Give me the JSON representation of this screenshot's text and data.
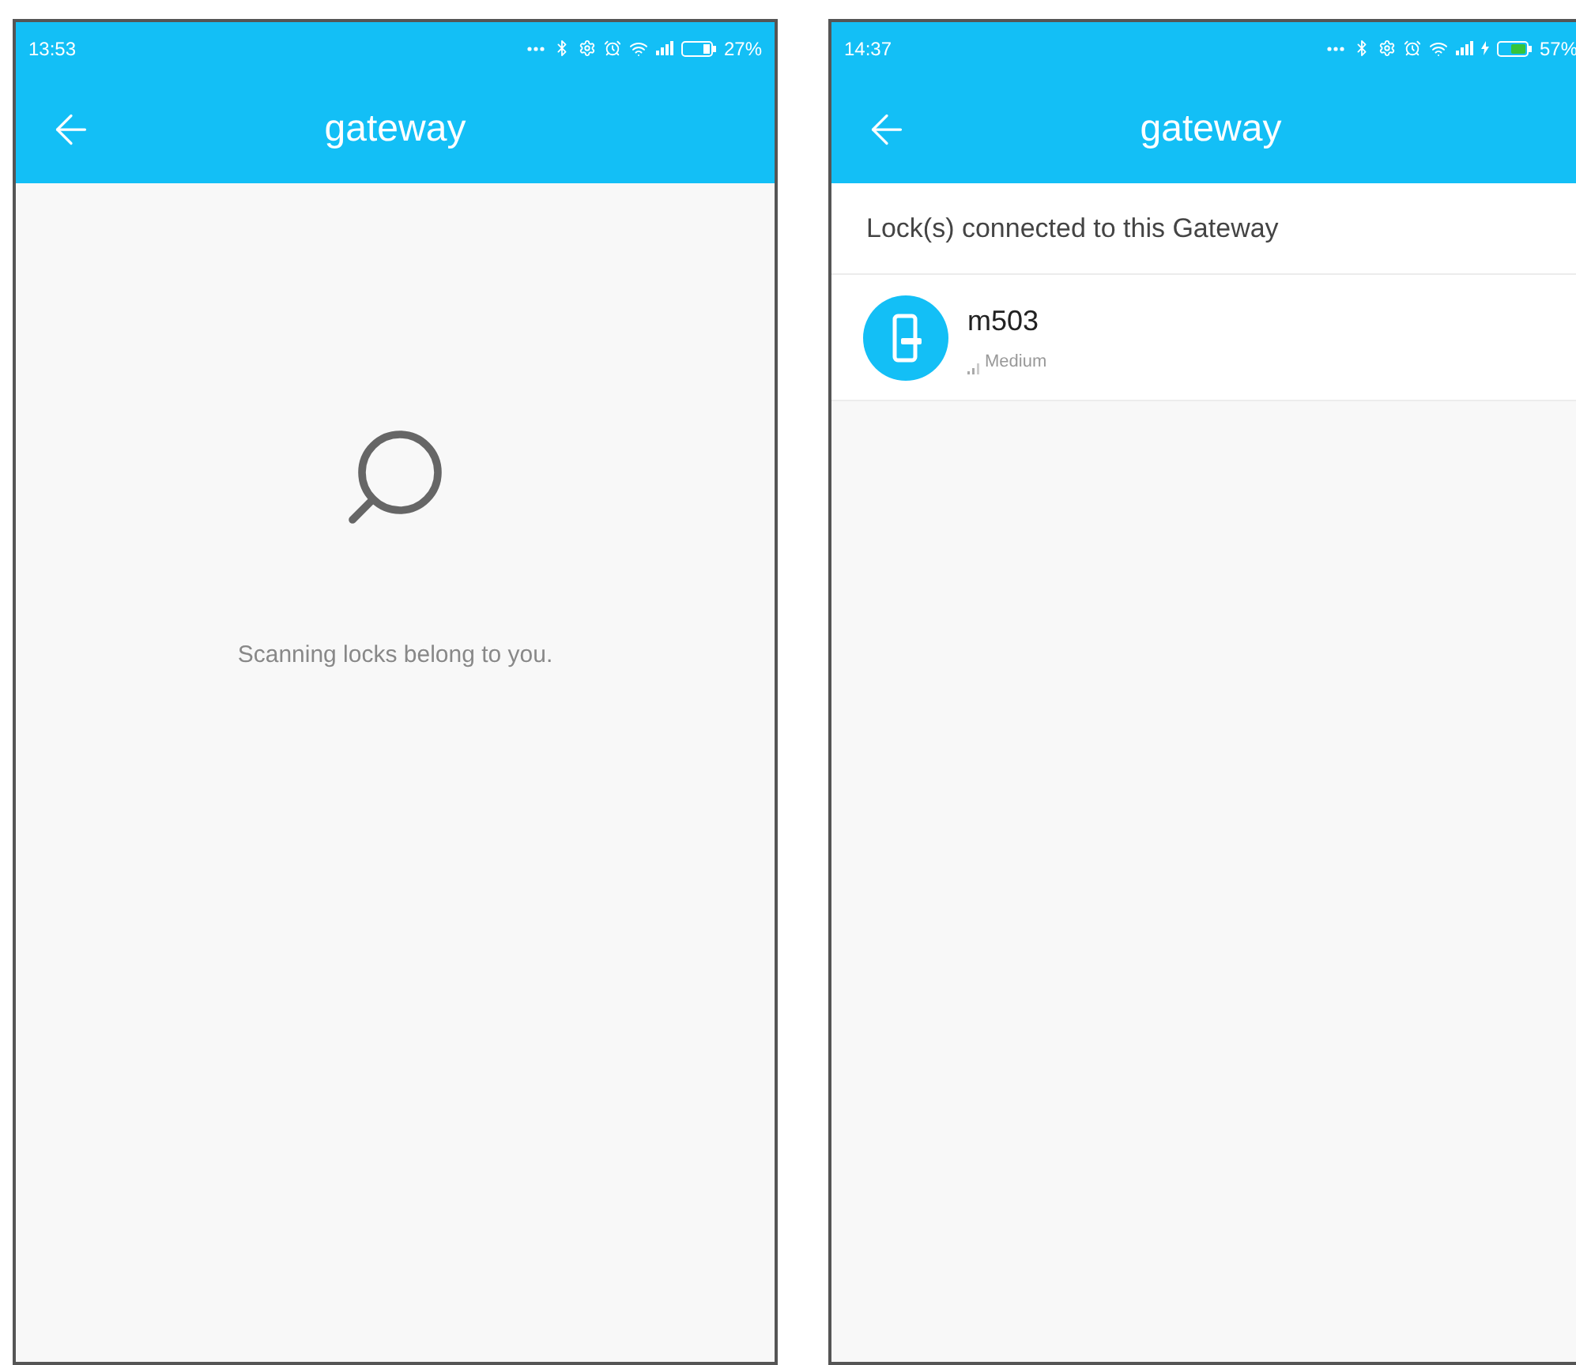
{
  "screens": [
    {
      "status_bar": {
        "time": "13:53",
        "battery": "27%",
        "charging": false
      },
      "header": {
        "title": "gateway"
      },
      "content": {
        "kind": "scanning",
        "message": "Scanning locks belong to you."
      }
    },
    {
      "status_bar": {
        "time": "14:37",
        "battery": "57%",
        "charging": true
      },
      "header": {
        "title": "gateway"
      },
      "content": {
        "kind": "list",
        "heading": "Lock(s) connected to this Gateway",
        "locks": [
          {
            "name": "m503",
            "signal": "Medium"
          }
        ]
      }
    }
  ]
}
